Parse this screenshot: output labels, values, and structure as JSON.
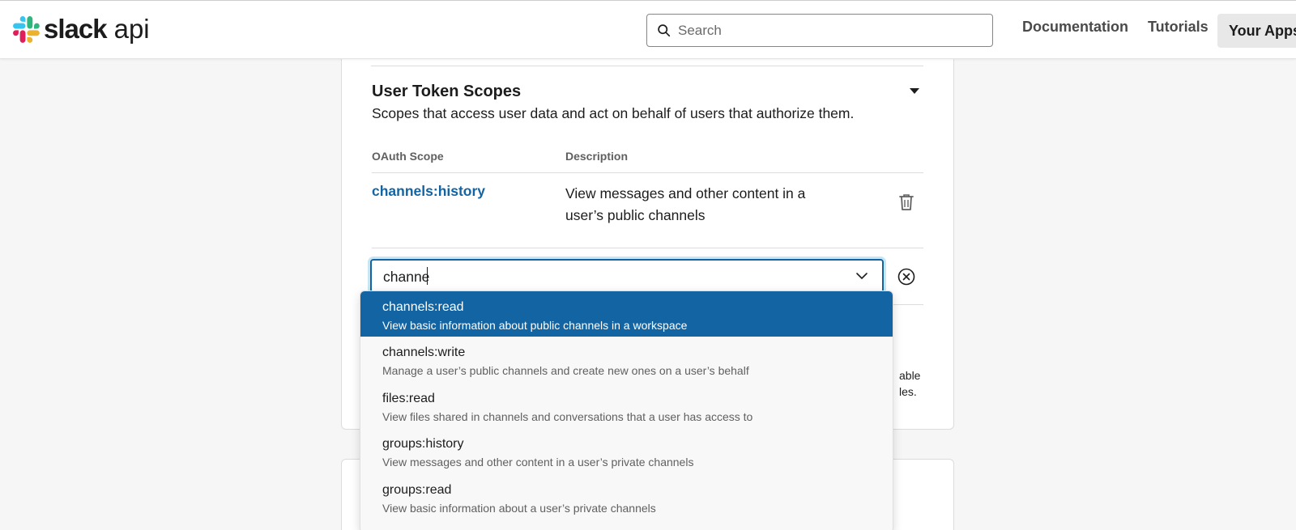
{
  "header": {
    "logo_brand": "slack",
    "logo_product": "api",
    "search_placeholder": "Search",
    "nav": [
      {
        "label": "Documentation"
      },
      {
        "label": "Tutorials"
      },
      {
        "label": "Your Apps"
      }
    ]
  },
  "section": {
    "title": "User Token Scopes",
    "description": "Scopes that access user data and act on behalf of users that authorize them.",
    "col_scope": "OAuth Scope",
    "col_description": "Description",
    "scopes": [
      {
        "name": "channels:history",
        "description": "View messages and other content in a user’s public channels"
      }
    ]
  },
  "scope_select": {
    "value": "channe"
  },
  "dropdown": {
    "options": [
      {
        "name": "channels:read",
        "description": "View basic information about public channels in a workspace",
        "active": true
      },
      {
        "name": "channels:write",
        "description": "Manage a user’s public channels and create new ones on a user’s behalf"
      },
      {
        "name": "files:read",
        "description": "View files shared in channels and conversations that a user has access to"
      },
      {
        "name": "groups:history",
        "description": "View messages and other content in a user’s private channels"
      },
      {
        "name": "groups:read",
        "description": "View basic information about a user’s private channels"
      }
    ]
  },
  "obscured_text": {
    "line1": "able",
    "line2": "les."
  },
  "colors": {
    "accent": "#1264a3",
    "text": "#1d1c1d"
  }
}
